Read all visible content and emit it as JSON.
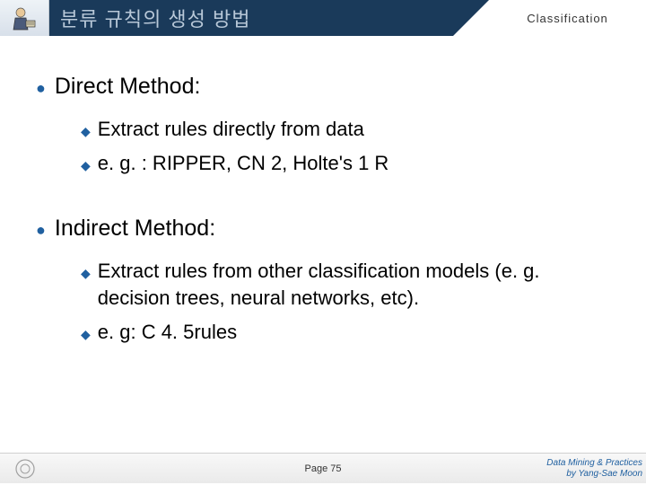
{
  "header": {
    "title": "분류 규칙의 생성 방법",
    "category": "Classification"
  },
  "content": {
    "section1": {
      "title": "Direct Method:",
      "items": [
        "Extract rules directly from data",
        "e. g. : RIPPER, CN 2, Holte's 1 R"
      ]
    },
    "section2": {
      "title": "Indirect Method:",
      "items": [
        "Extract rules from other classification models (e. g. decision trees, neural networks, etc).",
        "e. g: C 4. 5rules"
      ]
    }
  },
  "footer": {
    "page": "Page 75",
    "credit_line1": "Data Mining & Practices",
    "credit_line2": "by Yang-Sae Moon"
  }
}
